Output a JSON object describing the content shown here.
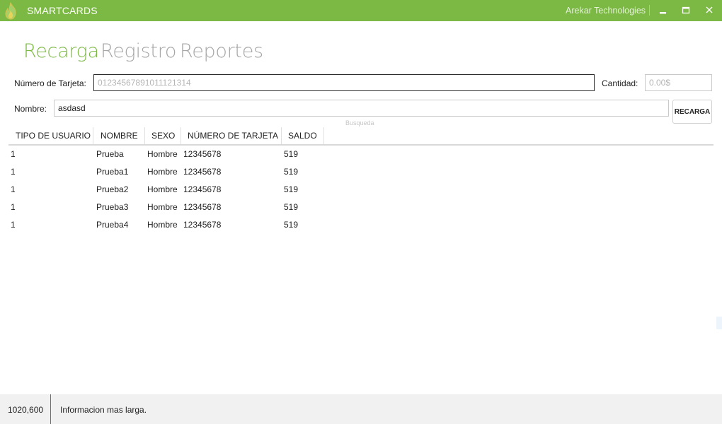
{
  "window": {
    "title": "SMARTCARDS",
    "company": "Arekar Technologies",
    "accent_color": "#7cb944",
    "logo_icon": "flame-icon",
    "controls": [
      "minimize-icon",
      "maximize-icon",
      "close-icon"
    ]
  },
  "nav": {
    "tabs": [
      {
        "label": "Recarga",
        "active": true
      },
      {
        "label": "Registro",
        "active": false
      },
      {
        "label": "Reportes",
        "active": false
      }
    ]
  },
  "form": {
    "card_label": "Número de Tarjeta:",
    "card_placeholder": "01234567891011121314",
    "card_value": "",
    "amount_label": "Cantidad:",
    "amount_placeholder": "0.00$",
    "amount_value": "",
    "name_label": "Nombre:",
    "name_value": "asdasd",
    "search_hint": "Busqueda",
    "recharge_button": "RECARGA"
  },
  "table": {
    "columns": [
      "TIPO DE USUARIO",
      "NOMBRE",
      "SEXO",
      "NÚMERO DE TARJETA",
      "SALDO"
    ],
    "rows": [
      [
        "1",
        "Prueba",
        "Hombre",
        "12345678",
        "519"
      ],
      [
        "1",
        "Prueba1",
        "Hombre",
        "12345678",
        "519"
      ],
      [
        "1",
        "Prueba2",
        "Hombre",
        "12345678",
        "519"
      ],
      [
        "1",
        "Prueba3",
        "Hombre",
        "12345678",
        "519"
      ],
      [
        "1",
        "Prueba4",
        "Hombre",
        "12345678",
        "519"
      ]
    ]
  },
  "status": {
    "size": "1020,600",
    "message": "Informacion mas larga."
  }
}
